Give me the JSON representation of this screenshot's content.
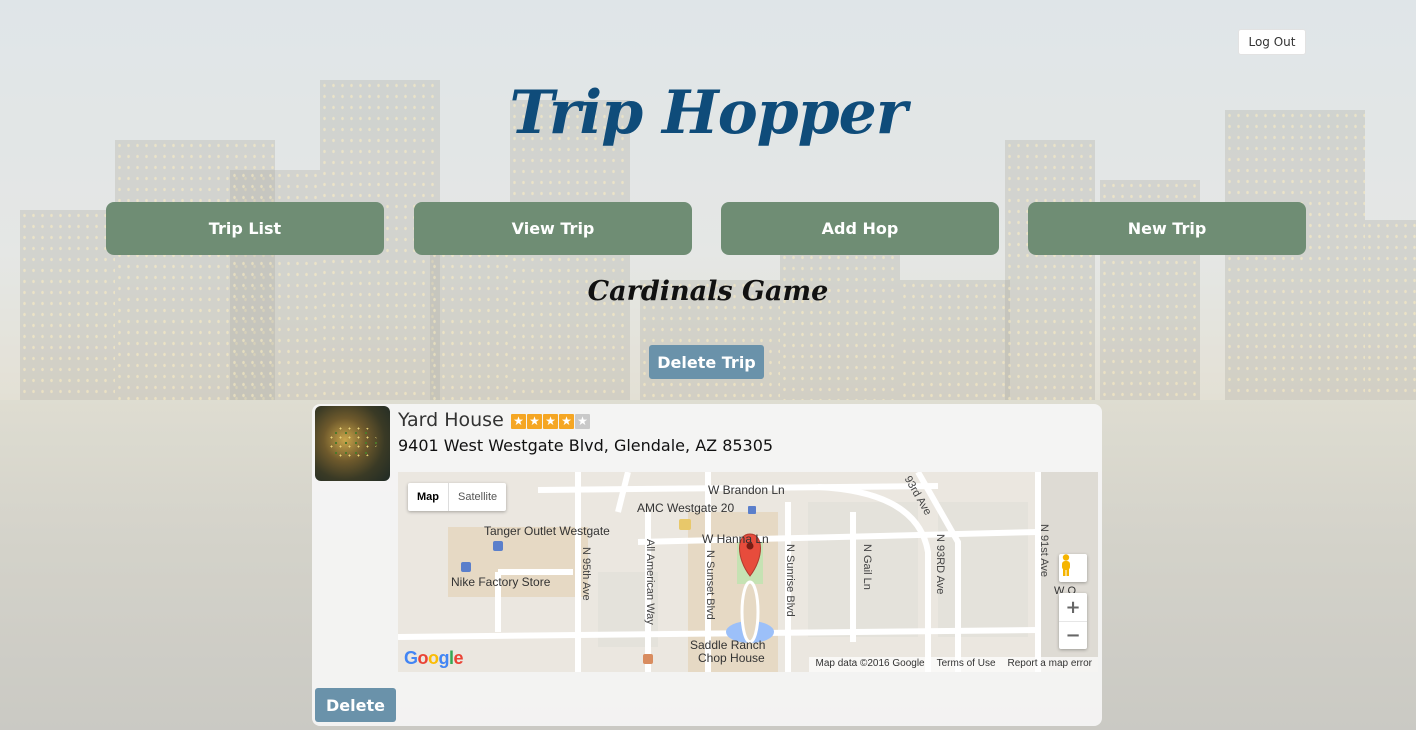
{
  "header": {
    "logout_label": "Log Out",
    "brand": "Trip Hopper"
  },
  "nav": {
    "items": [
      {
        "label": "Trip List"
      },
      {
        "label": "View Trip"
      },
      {
        "label": "Add Hop"
      },
      {
        "label": "New Trip"
      }
    ]
  },
  "trip": {
    "title": "Cardinals Game",
    "delete_label": "Delete Trip"
  },
  "hop": {
    "name": "Yard House",
    "rating": 4,
    "rating_max": 5,
    "address": "9401 West Westgate Blvd, Glendale, AZ 85305",
    "delete_label": "Delete"
  },
  "map": {
    "type_options": [
      "Map",
      "Satellite"
    ],
    "selected_type": "Map",
    "labels": {
      "brandon": "W Brandon Ln",
      "amc": "AMC Westgate 20",
      "tanger": "Tanger Outlet Westgate",
      "hanna": "W Hanna Ln",
      "nike": "Nike Factory Store",
      "saddle1": "Saddle Ranch",
      "saddle2": "Chop House",
      "n93rd_top": "93rd Ave",
      "n95th": "N 95th Ave",
      "allamerican": "All American Way",
      "nsunset": "N Sunset Blvd",
      "nsunrise": "N Sunrise Blvd",
      "ngail": "N Gail Ln",
      "n93rd": "N 93RD Ave",
      "n91st": "N 91st Ave",
      "wo": "W O"
    },
    "zoom_in": "+",
    "zoom_out": "−",
    "logo": "Google",
    "attribution": [
      "Map data ©2016 Google",
      "Terms of Use",
      "Report a map error"
    ]
  },
  "colors": {
    "nav_green": "#6f8d74",
    "button_blue": "#6a92aa",
    "brand_blue": "#0f4c7a",
    "star": "#f5a623"
  }
}
